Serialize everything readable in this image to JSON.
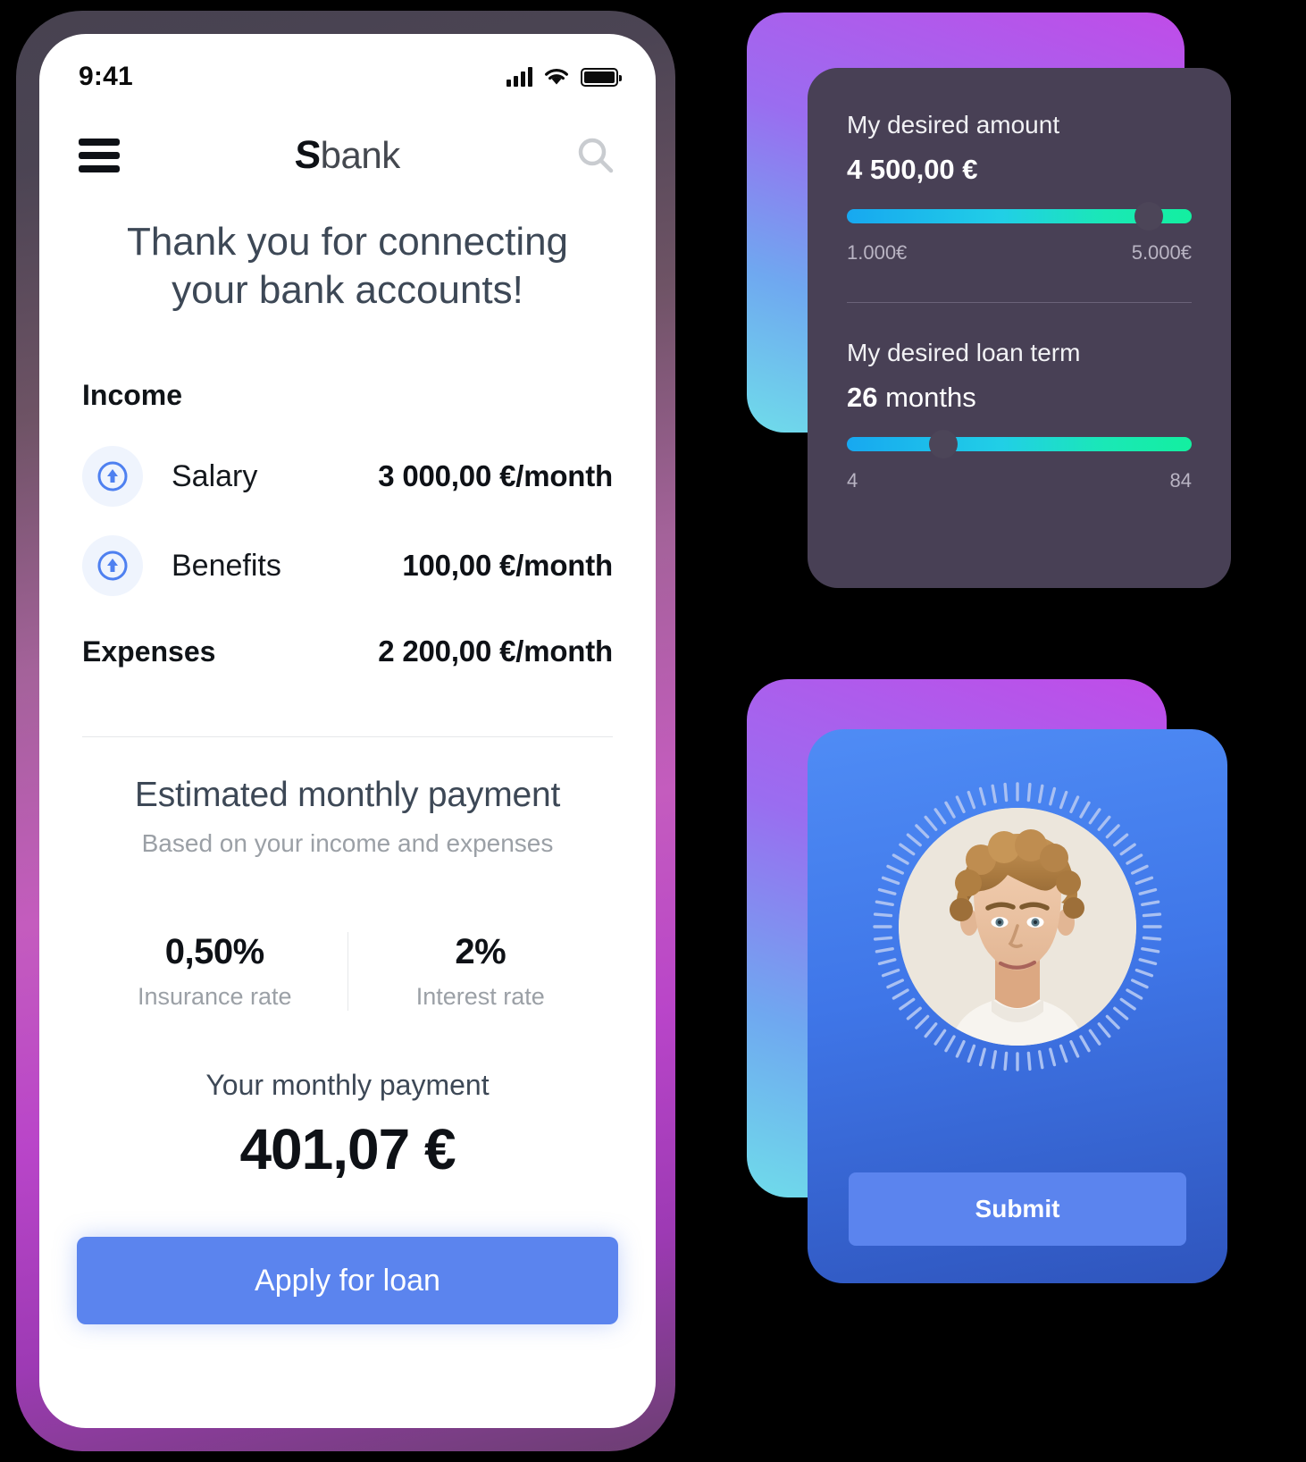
{
  "phone": {
    "status_bar": {
      "time": "9:41",
      "signal_icon": "cellular-signal-icon",
      "wifi_icon": "wifi-icon",
      "battery_icon": "battery-full-icon"
    },
    "header": {
      "menu_icon": "hamburger-menu-icon",
      "brand_mark": "S",
      "brand_name": "bank",
      "search_icon": "search-icon"
    },
    "hero_heading": "Thank you for connecting your bank accounts!",
    "income": {
      "title": "Income",
      "rows": [
        {
          "icon": "arrow-up-circle-icon",
          "label": "Salary",
          "value": "3 000,00 €/month"
        },
        {
          "icon": "arrow-up-circle-icon",
          "label": "Benefits",
          "value": "100,00 €/month"
        }
      ]
    },
    "expenses": {
      "label": "Expenses",
      "value": "2 200,00 €/month"
    },
    "estimate": {
      "title": "Estimated monthly payment",
      "subtitle": "Based on your income and expenses",
      "rates": [
        {
          "value": "0,50%",
          "label": "Insurance rate"
        },
        {
          "value": "2%",
          "label": "Interest rate"
        }
      ],
      "payment_label": "Your monthly payment",
      "payment_value": "401,07 €"
    },
    "apply_button": "Apply for loan"
  },
  "loan_card": {
    "amount": {
      "label": "My desired amount",
      "value": "4 500,00 €",
      "slider_percent": 87.5,
      "min_label": "1.000€",
      "max_label": "5.000€"
    },
    "term": {
      "label": "My desired loan term",
      "value_number": "26",
      "value_unit": "months",
      "slider_percent": 28,
      "min_label": "4",
      "max_label": "84"
    }
  },
  "face_card": {
    "avatar_icon": "user-portrait-photo",
    "scan_ring_icon": "face-scan-ring-icon",
    "submit_button": "Submit"
  },
  "colors": {
    "accent_blue": "#5b84ee",
    "slider_start": "#17a8f0",
    "slider_end": "#13efa0",
    "dark_card": "#484055",
    "heading_text": "#3d4856",
    "muted_text": "#9ba0a6"
  }
}
